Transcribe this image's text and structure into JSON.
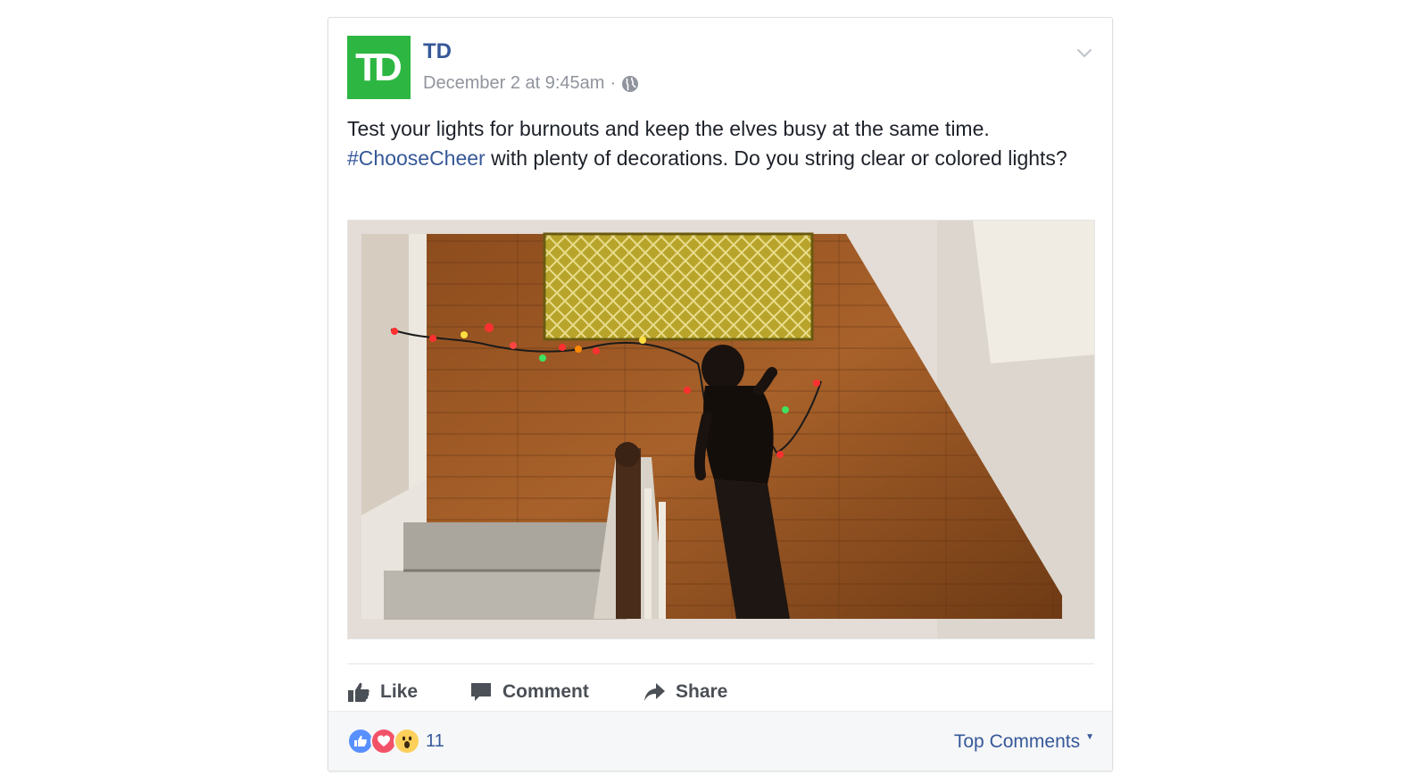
{
  "post": {
    "page_name": "TD",
    "logo_text": "TD",
    "timestamp": "December 2 at 9:45am",
    "separator": "·",
    "text_part1": "Test your lights for burnouts and keep the elves busy at the same time.",
    "hashtag": "#ChooseCheer",
    "text_part2": " with plenty of decorations. Do you string clear or colored lights?"
  },
  "actions": {
    "like": "Like",
    "comment": "Comment",
    "share": "Share"
  },
  "footer": {
    "reaction_count": "11",
    "top_comments": "Top Comments"
  },
  "colors": {
    "brand_green": "#2db742",
    "link_blue": "#365899",
    "meta_gray": "#90949c"
  },
  "icons": {
    "globe": "globe-icon",
    "options": "chevron-down-icon",
    "like": "thumbs-up-icon",
    "comment": "speech-bubble-icon",
    "share": "share-arrow-icon"
  }
}
